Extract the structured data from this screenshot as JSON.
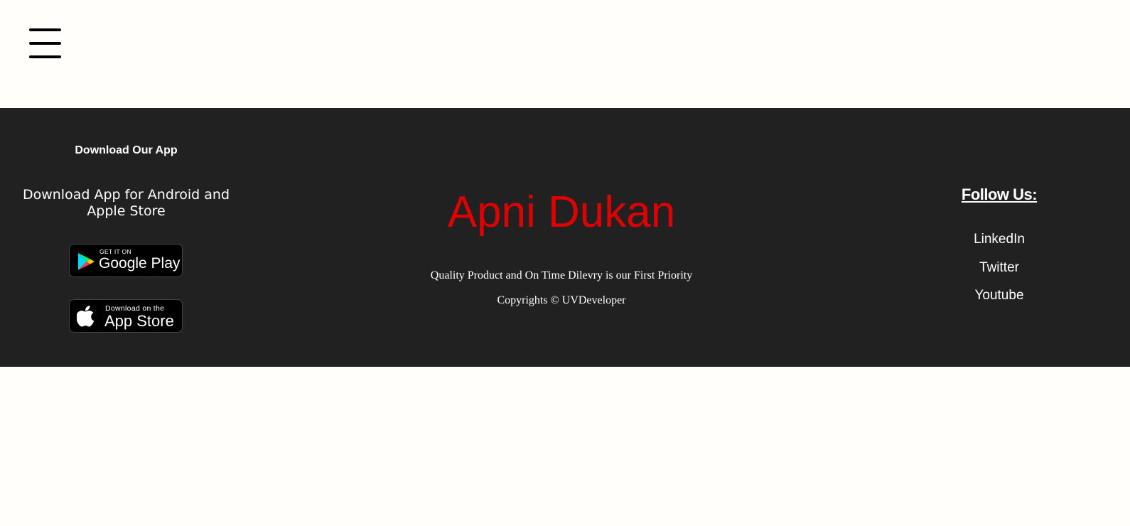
{
  "header": {
    "menu_icon": "hamburger-icon"
  },
  "footer": {
    "download": {
      "title": "Download Our App",
      "subtitle": "Download App for Android and Apple Store",
      "google_play": {
        "small": "GET IT ON",
        "big": "Google Play",
        "icon": "google-play-icon"
      },
      "app_store": {
        "small": "Download on the",
        "big": "App Store",
        "icon": "apple-icon"
      }
    },
    "brand": {
      "name": "Apni Dukan",
      "tagline": "Quality Product and On Time Dilevry is our First Priority",
      "copyright": "Copyrights © UVDeveloper",
      "color": "#e00000"
    },
    "social": {
      "title": "Follow Us:",
      "links": [
        "LinkedIn",
        "Twitter",
        "Youtube"
      ]
    },
    "background": "#222121"
  }
}
